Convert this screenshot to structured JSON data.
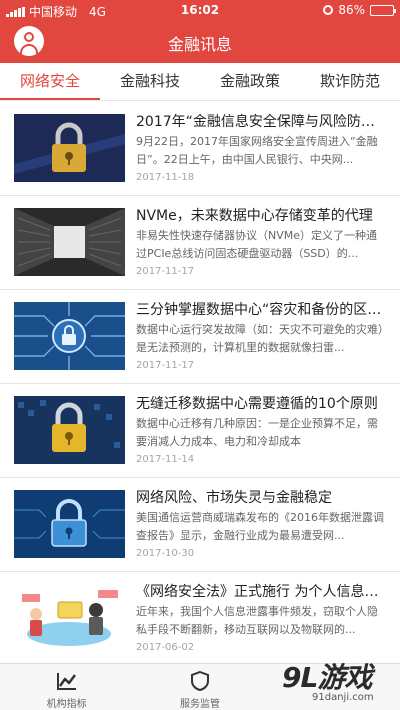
{
  "status_bar": {
    "carrier": "中国移动",
    "network": "4G",
    "time": "16:02",
    "battery": "86%"
  },
  "header": {
    "title": "金融讯息"
  },
  "tabs": [
    {
      "label": "网络安全",
      "active": true
    },
    {
      "label": "金融科技",
      "active": false
    },
    {
      "label": "金融政策",
      "active": false
    },
    {
      "label": "欺诈防范",
      "active": false
    }
  ],
  "articles": [
    {
      "title": "2017年“金融信息安全保障与风险防范...",
      "summary": "9月22日，2017年国家网络安全宣传周进入“金融日”。22日上午，由中国人民银行、中央网...",
      "date": "2017-11-18"
    },
    {
      "title": "NVMe，未来数据中心存储变革的代理",
      "summary": "非易失性快速存储器协议（NVMe）定义了一种通过PCIe总线访问固态硬盘驱动器（SSD）的...",
      "date": "2017-11-17"
    },
    {
      "title": "三分钟掌握数据中心“容灾和备份的区别”",
      "summary": "数据中心运行突发故障（如：天灾不可避免的灾难）是无法预测的，计算机里的数据就像扫雷...",
      "date": "2017-11-17"
    },
    {
      "title": "无缝迁移数据中心需要遵循的10个原则",
      "summary": "数据中心迁移有几种原因：一是企业预算不足，需要消减人力成本、电力和冷却成本",
      "date": "2017-11-14"
    },
    {
      "title": "网络风险、市场失灵与金融稳定",
      "summary": "美国通信运营商威瑞森发布的《2016年数据泄露调查报告》显示，金融行业成为最易遭受网...",
      "date": "2017-10-30"
    },
    {
      "title": "《网络安全法》正式施行 为个人信息加...",
      "summary": "近年来，我国个人信息泄露事件频发，窃取个人隐私手段不断翻新，移动互联网以及物联网的...",
      "date": "2017-06-02"
    }
  ],
  "bottom_nav": [
    {
      "label": "机构指标",
      "icon": "line-chart-icon"
    },
    {
      "label": "服务监管",
      "icon": "shield-icon"
    }
  ],
  "watermark": {
    "logo": "9L游戏",
    "url": "91danji.com"
  },
  "colors": {
    "brand_red": "#e2473f",
    "divider": "#e6e6e6",
    "date_gray": "#a5a5a5"
  }
}
